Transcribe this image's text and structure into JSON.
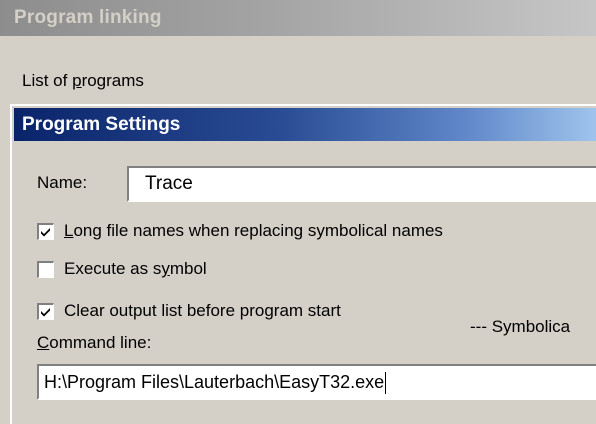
{
  "window": {
    "title": "Program linking"
  },
  "programs": {
    "list_label_pre": "List of ",
    "list_label_key": "p",
    "list_label_post": "rograms"
  },
  "settings": {
    "title": "Program Settings",
    "name_label": "Name:",
    "name_value": "Trace",
    "options": [
      {
        "key": "L",
        "rest": "ong file names when replacing symbolical names",
        "checked": true
      },
      {
        "pre": "Execute as s",
        "key": "y",
        "post": "mbol",
        "checked": false
      },
      {
        "label": "Clear output list before program start",
        "checked": true
      }
    ],
    "command_label_key": "C",
    "command_label_rest": "ommand line:",
    "command_value": "H:\\Program Files\\Lauterbach\\EasyT32.exe",
    "symbolic_label": "--- Symbolica"
  },
  "colors": {
    "face": "#d4d0c8",
    "active_title_start": "#0a246a",
    "active_title_end": "#a6caf0",
    "inactive_title": "#8d8d8d"
  },
  "icons": {
    "checkbox": "checkmark-icon"
  }
}
